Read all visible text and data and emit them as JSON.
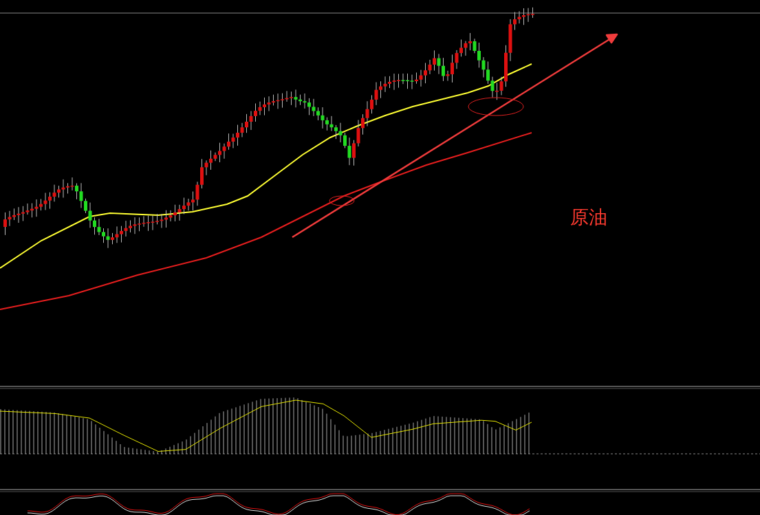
{
  "chart": {
    "label": "原油"
  }
}
